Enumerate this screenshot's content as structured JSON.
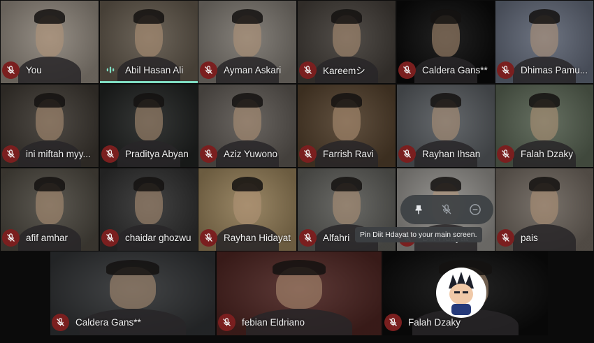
{
  "colors": {
    "mic_off_bg": "#7a1f1f",
    "speaking_accent": "#7fdcc1"
  },
  "participants": [
    {
      "name": "You",
      "muted": true,
      "bg": "#8a8278"
    },
    {
      "name": "Abil Hasan Ali",
      "muted": false,
      "bg": "#5d5448"
    },
    {
      "name": "Ayman Askari",
      "muted": true,
      "bg": "#78736c"
    },
    {
      "name": "Kareemシ",
      "muted": true,
      "bg": "#403b36"
    },
    {
      "name": "Caldera Gans**",
      "muted": true,
      "bg": "#090909"
    },
    {
      "name": "Dhimas Pamu...",
      "muted": true,
      "bg": "#5e6574"
    },
    {
      "name": "ini miftah myy...",
      "muted": true,
      "bg": "#3b3630"
    },
    {
      "name": "Praditya Abyan",
      "muted": true,
      "bg": "#1f2120"
    },
    {
      "name": "Aziz Yuwono",
      "muted": true,
      "bg": "#5a5550"
    },
    {
      "name": "Farrish Ravi",
      "muted": true,
      "bg": "#4f3d2a"
    },
    {
      "name": "Rayhan Ihsan",
      "muted": true,
      "bg": "#54585c"
    },
    {
      "name": "Falah Dzaky",
      "muted": true,
      "bg": "#556050"
    },
    {
      "name": "afif amhar",
      "muted": true,
      "bg": "#4a463e"
    },
    {
      "name": "chaidar ghozwu",
      "muted": true,
      "bg": "#2e2e2e"
    },
    {
      "name": "Rayhan Hidayat",
      "muted": true,
      "bg": "#8f7a55"
    },
    {
      "name": "Alfahri",
      "muted": true,
      "bg": "#5a5a56"
    },
    {
      "name": "Diit Hdayat",
      "muted": true,
      "bg": "#8c8a86"
    },
    {
      "name": "pais",
      "muted": true,
      "bg": "#6a625a"
    }
  ],
  "bottom_participants": [
    {
      "name": "Caldera Gans**",
      "muted": true,
      "bg": "#2e3032"
    },
    {
      "name": "febian Eldriano",
      "muted": true,
      "bg": "#4a2320"
    },
    {
      "name": "Falah Dzaky",
      "muted": true,
      "bg": "#0b0b0b"
    }
  ],
  "hover": {
    "pin_icon": "pin-icon",
    "mute_icon": "mic-off-icon",
    "remove_icon": "remove-circle-icon",
    "tooltip": "Pin Diit Hdayat to your main screen."
  }
}
